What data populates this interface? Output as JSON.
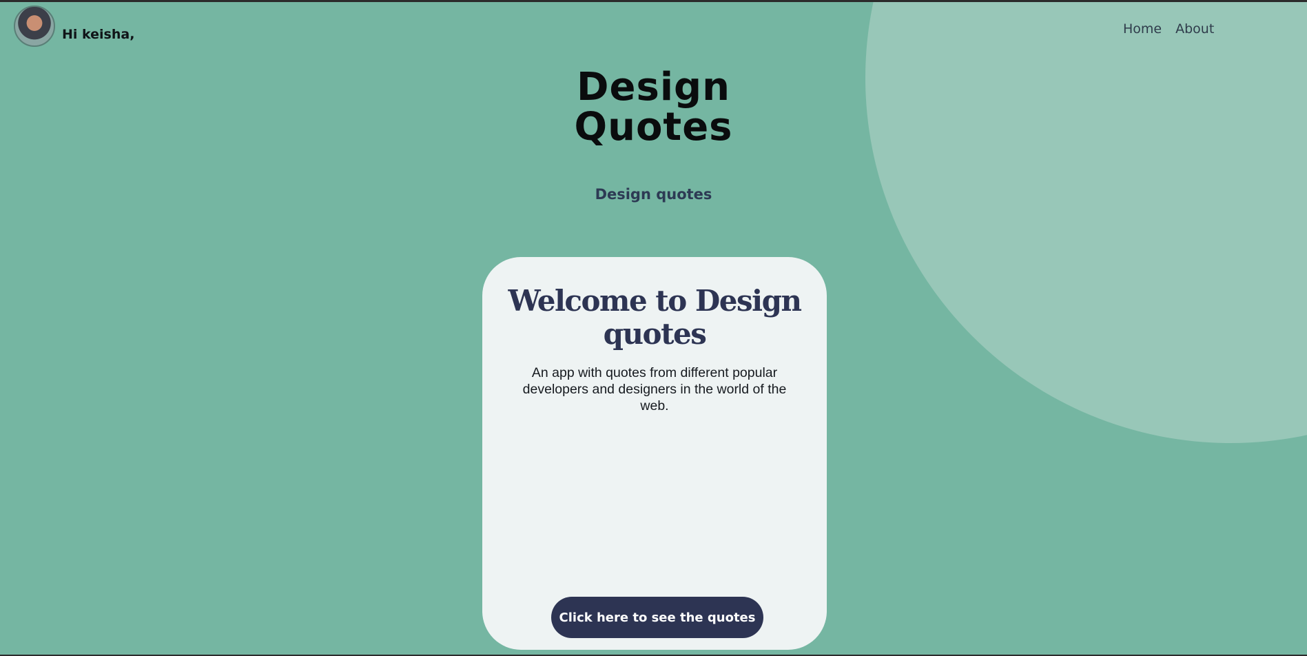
{
  "header": {
    "greeting": "Hi keisha,",
    "avatar_icon": "user-avatar-photo"
  },
  "nav": {
    "items": [
      {
        "label": "Home"
      },
      {
        "label": "About"
      }
    ]
  },
  "hero": {
    "title_line1": "Design",
    "title_line2": "Quotes",
    "subtitle": "Design quotes"
  },
  "card": {
    "title": "Welcome to Design quotes",
    "description": "An app with quotes from different popular developers and designers in the world of the web.",
    "cta_label": "Click here to see the quotes"
  },
  "colors": {
    "background": "#75b6a2",
    "accent_circle": "#98c7b8",
    "card_bg": "#eef3f3",
    "primary": "#2d3453"
  }
}
